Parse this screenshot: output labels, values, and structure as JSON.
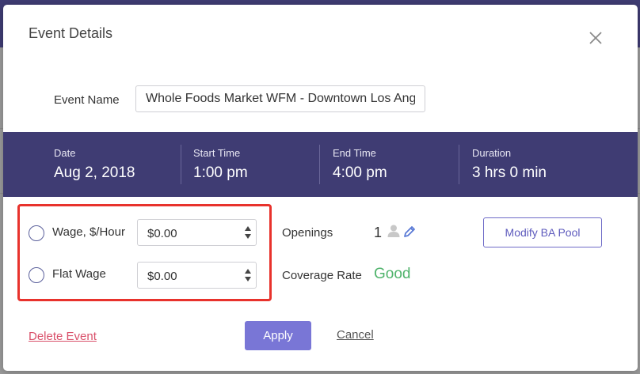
{
  "modal": {
    "title": "Event Details",
    "event_name_label": "Event Name",
    "event_name_value": "Whole Foods Market WFM - Downtown Los Ang"
  },
  "schedule": {
    "date_label": "Date",
    "date_value": "Aug 2, 2018",
    "start_label": "Start Time",
    "start_value": "1:00 pm",
    "end_label": "End Time",
    "end_value": "4:00 pm",
    "duration_label": "Duration",
    "duration_value": "3 hrs 0 min"
  },
  "wages": {
    "hourly_label": "Wage, $/Hour",
    "hourly_value": "$0.00",
    "flat_label": "Flat Wage",
    "flat_value": "$0.00"
  },
  "staffing": {
    "openings_label": "Openings",
    "openings_value": "1",
    "coverage_label": "Coverage Rate",
    "coverage_value": "Good",
    "coverage_color": "#4fb36b"
  },
  "actions": {
    "modify_pool_label": "Modify BA Pool",
    "delete_label": "Delete Event",
    "apply_label": "Apply",
    "cancel_label": "Cancel"
  },
  "colors": {
    "band": "#3f3c73",
    "accent": "#7976d6",
    "highlight": "#e8322c",
    "delete": "#d9506a"
  }
}
